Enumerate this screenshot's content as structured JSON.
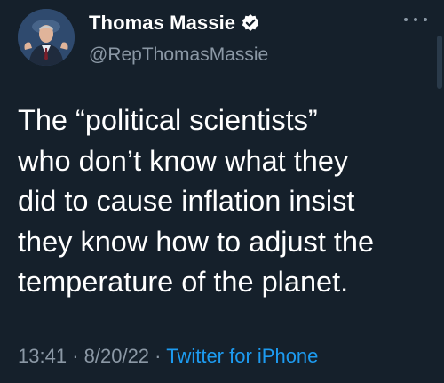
{
  "author": {
    "display_name": "Thomas Massie",
    "handle": "@RepThomasMassie",
    "verified": true,
    "avatar_icon": "profile-photo"
  },
  "tweet": {
    "text": "The “political scientists”\nwho don’t know what they\ndid to cause inflation insist\nthey know how to adjust the\ntemperature of the planet."
  },
  "meta": {
    "time": "13:41",
    "separator": "·",
    "date": "8/20/22",
    "source": "Twitter for iPhone"
  },
  "colors": {
    "background": "#15202b",
    "primary_text": "#ffffff",
    "secondary_text": "#8b98a5",
    "link": "#1d9bf0"
  }
}
